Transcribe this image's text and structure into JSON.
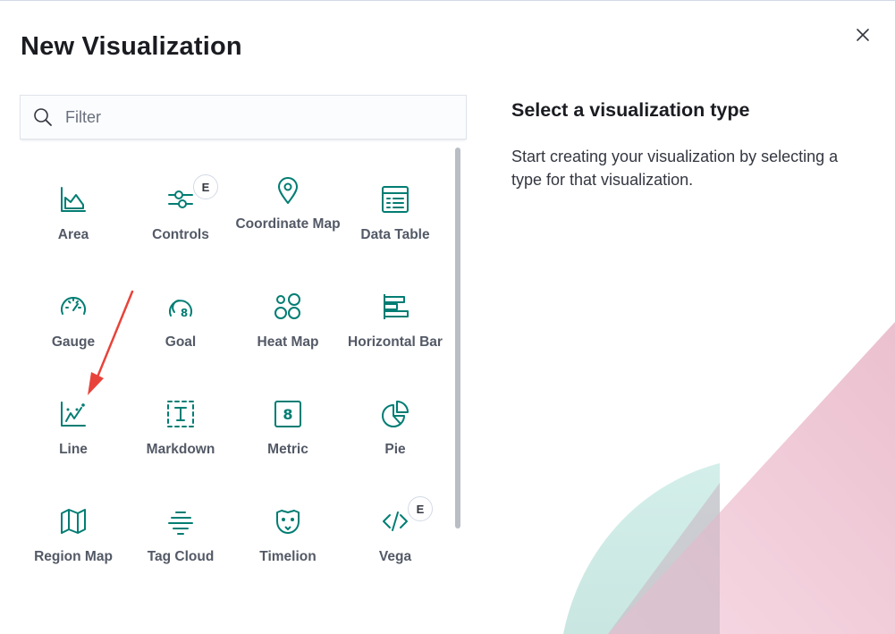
{
  "dialog": {
    "title": "New Visualization",
    "close_icon": "close-icon"
  },
  "search": {
    "placeholder": "Filter",
    "value": "",
    "icon": "search-icon"
  },
  "types": [
    {
      "label": "Area",
      "icon": "area-chart-icon",
      "badge": ""
    },
    {
      "label": "Controls",
      "icon": "controls-sliders-icon",
      "badge": "E"
    },
    {
      "label": "Coordinate Map",
      "icon": "map-pin-icon",
      "badge": ""
    },
    {
      "label": "Data Table",
      "icon": "table-icon",
      "badge": ""
    },
    {
      "label": "Gauge",
      "icon": "gauge-icon",
      "badge": ""
    },
    {
      "label": "Goal",
      "icon": "goal-icon",
      "badge": ""
    },
    {
      "label": "Heat Map",
      "icon": "heatmap-icon",
      "badge": ""
    },
    {
      "label": "Horizontal Bar",
      "icon": "horizontal-bar-icon",
      "badge": ""
    },
    {
      "label": "Line",
      "icon": "line-chart-icon",
      "badge": ""
    },
    {
      "label": "Markdown",
      "icon": "markdown-icon",
      "badge": ""
    },
    {
      "label": "Metric",
      "icon": "metric-icon",
      "badge": ""
    },
    {
      "label": "Pie",
      "icon": "pie-chart-icon",
      "badge": ""
    },
    {
      "label": "Region Map",
      "icon": "region-map-icon",
      "badge": ""
    },
    {
      "label": "Tag Cloud",
      "icon": "tag-cloud-icon",
      "badge": ""
    },
    {
      "label": "Timelion",
      "icon": "timelion-icon",
      "badge": ""
    },
    {
      "label": "Vega",
      "icon": "code-icon",
      "badge": "E"
    }
  ],
  "side": {
    "title": "Select a visualization type",
    "description": "Start creating your visualization by selecting a type for that visualization."
  },
  "colors": {
    "accent": "#017d73",
    "annotation_arrow": "#e8433a",
    "decor_pink": "#f3c5d4",
    "decor_teal": "#d4efea"
  }
}
